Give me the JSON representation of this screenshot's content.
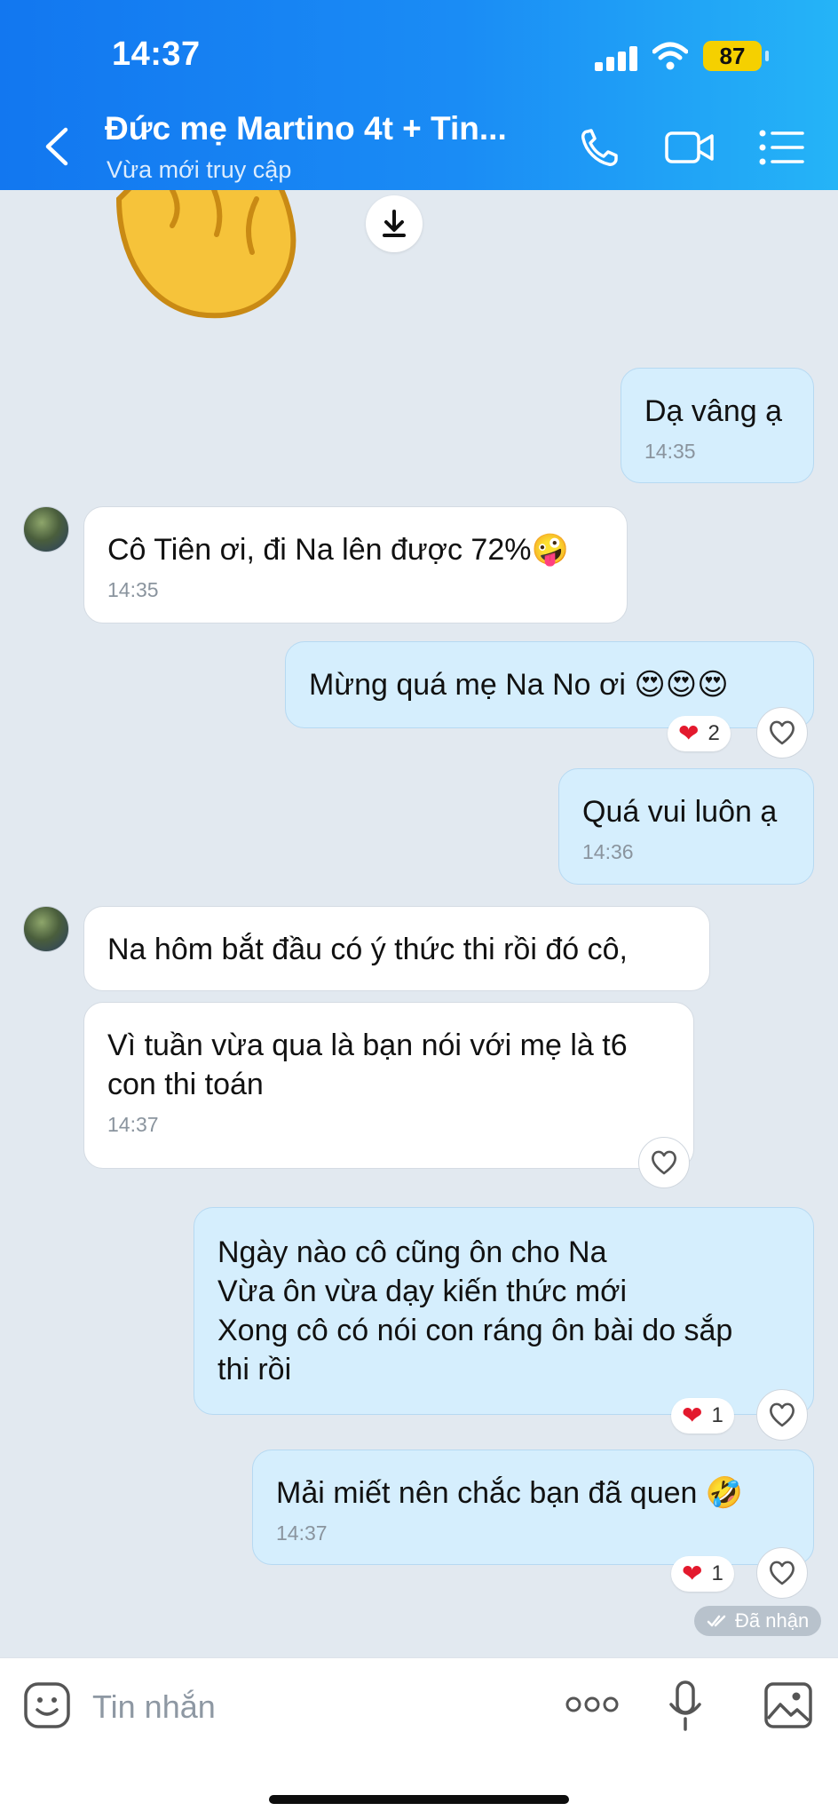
{
  "status_bar": {
    "time": "14:37",
    "battery": "87"
  },
  "header": {
    "title": "Đức mẹ Martino 4t + Tin...",
    "subtitle": "Vừa mới truy cập"
  },
  "messages": [
    {
      "text": "Dạ vâng ạ",
      "time": "14:35"
    },
    {
      "text": "Cô Tiên ơi, đi Na lên được 72%🤪",
      "time": "14:35"
    },
    {
      "text": "Mừng quá mẹ Na No ơi 😍😍😍",
      "reaction_count": "2"
    },
    {
      "text": "Quá vui luôn ạ",
      "time": "14:36"
    },
    {
      "text": "Na hôm bắt đầu có ý thức thi rồi đó cô,"
    },
    {
      "text": "Vì tuần vừa qua là bạn nói với mẹ là t6\ncon thi toán",
      "time": "14:37"
    },
    {
      "text": "Ngày nào cô cũng ôn cho Na\nVừa ôn vừa dạy kiến thức mới\nXong cô có nói con ráng ôn bài do sắp\nthi rồi",
      "reaction_count": "1"
    },
    {
      "text": "Mải miết nên chắc bạn đã quen 🤣",
      "time": "14:37",
      "reaction_count": "1"
    }
  ],
  "seen_status": "Đã nhận",
  "input": {
    "placeholder": "Tin nhắn"
  },
  "icons": [
    "back-arrow",
    "phone",
    "video-camera",
    "list-menu",
    "download",
    "heart",
    "emoji",
    "more",
    "microphone",
    "image"
  ],
  "colors": {
    "header_start": "#1277f0",
    "header_end": "#25b4f7",
    "outgoing_bubble": "#d5eefd",
    "incoming_bubble": "#ffffff",
    "reaction_heart": "#e3192d"
  }
}
